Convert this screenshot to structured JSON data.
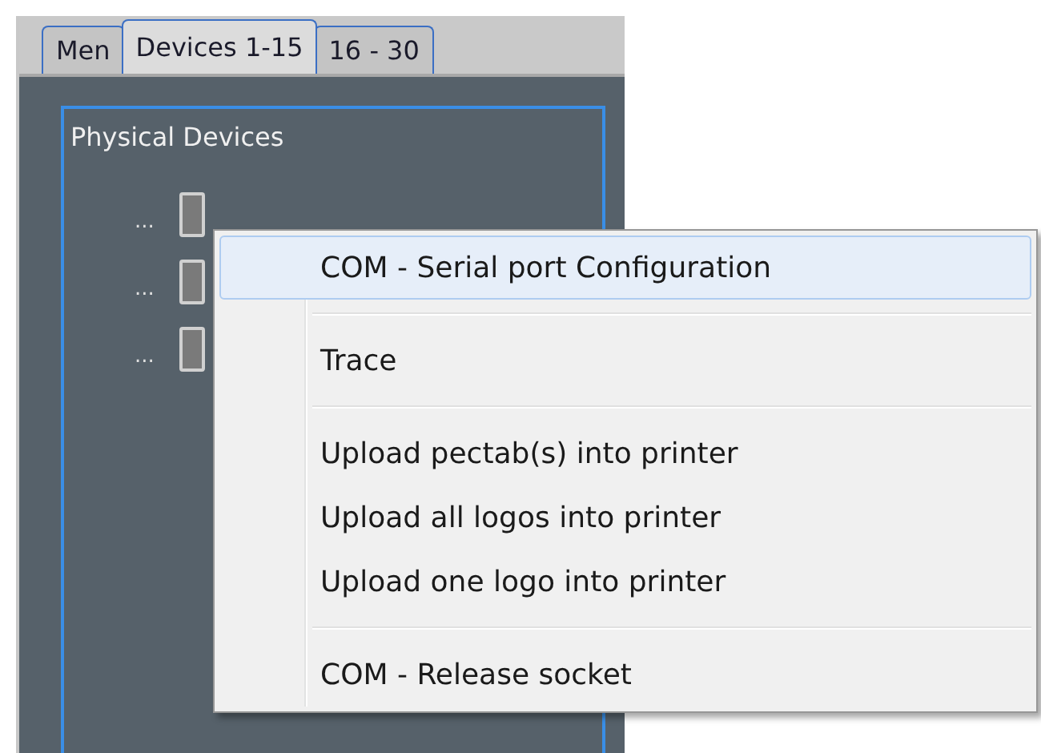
{
  "tabs": [
    {
      "label": "Men",
      "selected": false
    },
    {
      "label": "Devices 1-15",
      "selected": true
    },
    {
      "label": "16 - 30",
      "selected": false
    }
  ],
  "group": {
    "title": "Physical Devices",
    "devices": [
      {
        "label": "..."
      },
      {
        "label": "..."
      },
      {
        "label": "..."
      }
    ]
  },
  "context_menu": [
    {
      "kind": "item",
      "label": "COM - Serial port Configuration",
      "selected": true
    },
    {
      "kind": "separator"
    },
    {
      "kind": "item",
      "label": "Trace",
      "selected": false
    },
    {
      "kind": "separator"
    },
    {
      "kind": "item",
      "label": "Upload pectab(s) into printer",
      "selected": false
    },
    {
      "kind": "item",
      "label": "Upload all logos into printer",
      "selected": false
    },
    {
      "kind": "item",
      "label": "Upload one logo into printer",
      "selected": false
    },
    {
      "kind": "separator"
    },
    {
      "kind": "item",
      "label": "COM - Release socket",
      "selected": false
    }
  ]
}
